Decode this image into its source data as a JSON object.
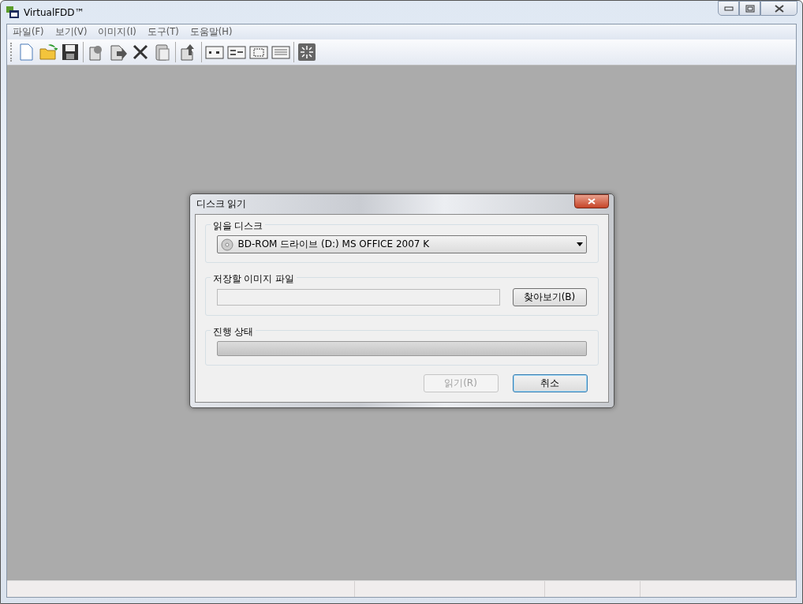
{
  "window": {
    "title": "VirtualFDD™"
  },
  "menu": [
    {
      "label": "파일(F)"
    },
    {
      "label": "보기(V)"
    },
    {
      "label": "이미지(I)"
    },
    {
      "label": "도구(T)"
    },
    {
      "label": "도움말(H)"
    }
  ],
  "dialog": {
    "title": "디스크 읽기",
    "disk_group": {
      "label": "읽을 디스크",
      "value": "BD-ROM 드라이브 (D:) MS OFFICE 2007 K"
    },
    "file_group": {
      "label": "저장할 이미지 파일",
      "browse": "찾아보기(B)"
    },
    "progress_group": {
      "label": "진행 상태",
      "level": 0
    },
    "buttons": [
      {
        "label": "읽기(R)",
        "disabled": true,
        "default": false
      },
      {
        "label": "취소",
        "disabled": false,
        "default": true
      }
    ]
  }
}
